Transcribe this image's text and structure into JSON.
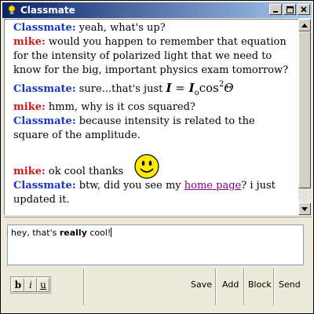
{
  "window": {
    "title": "Classmate",
    "icon": "lightbulb-icon",
    "controls": [
      "minimize-icon",
      "maximize-icon",
      "close-icon"
    ]
  },
  "chat": {
    "messages": [
      {
        "sender": "Classmate",
        "text": " yeah, what's up?"
      },
      {
        "sender": "mike",
        "text": " would you happen to remember that equation for the intensity of polarized light that we need to know for the big, important physics exam tomorrow?"
      },
      {
        "sender": "Classmate",
        "text": " sure...that's just ",
        "equation": {
          "lhs": "I",
          "eq": " = ",
          "base": "I",
          "sub": "o",
          "func": "cos",
          "sup": "2",
          "var": "Θ"
        }
      },
      {
        "sender": "mike",
        "text": " hmm, why is it cos squared?"
      },
      {
        "sender": "Classmate",
        "text": " because intensity is related to the square of the amplitude."
      },
      {
        "sender": "mike",
        "text": " ok cool thanks",
        "emoticon": "smiley-icon"
      },
      {
        "sender": "Classmate",
        "text_before": " btw, did you see my ",
        "link": "home page",
        "text_after": "? i just updated it."
      }
    ]
  },
  "compose": {
    "text_before": "hey, that's ",
    "text_bold": "really",
    "text_after": " cool!"
  },
  "toolbar": {
    "bold_label": "b",
    "italic_label": "i",
    "underline_label": "u",
    "save_label": "Save",
    "add_label": "Add",
    "block_label": "Block",
    "send_label": "Send"
  },
  "colors": {
    "classmate": "#1a35c8",
    "mike": "#c81a1a",
    "link": "#800080",
    "titlebar_start": "#0a246a",
    "titlebar_end": "#a6caf0"
  }
}
